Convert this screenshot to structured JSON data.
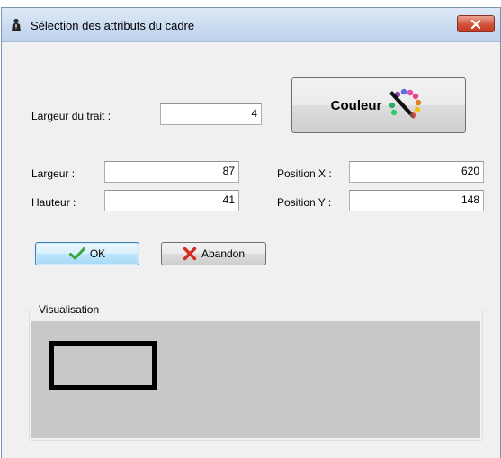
{
  "window": {
    "title": "Sélection des attributs du cadre",
    "icon": "tuxedo-person-icon"
  },
  "form": {
    "line_width_label": "Largeur du trait :",
    "line_width_value": "4",
    "width_label": "Largeur :",
    "width_value": "87",
    "height_label": "Hauteur :",
    "height_value": "41",
    "pos_x_label": "Position X :",
    "pos_x_value": "620",
    "pos_y_label": "Position Y :",
    "pos_y_value": "148"
  },
  "buttons": {
    "color_label": "Couleur",
    "color_icon": "palette-pen-icon",
    "ok_label": "OK",
    "cancel_label": "Abandon"
  },
  "preview": {
    "group_label": "Visualisation",
    "background": "#c8c8c8",
    "border_color": "#000000"
  }
}
